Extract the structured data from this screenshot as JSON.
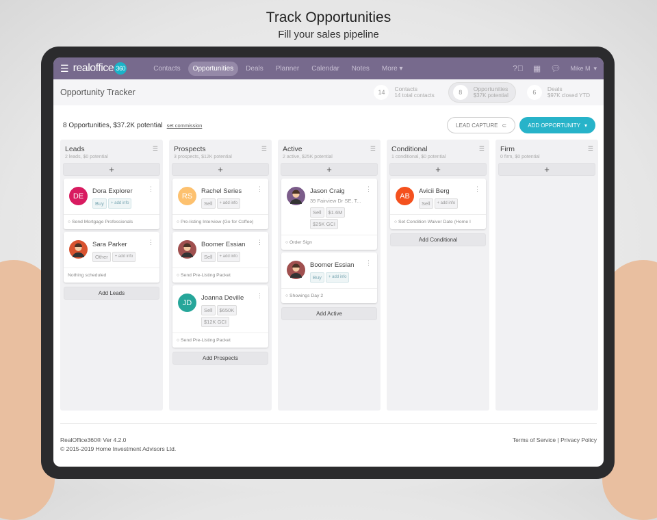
{
  "hero": {
    "title": "Track Opportunities",
    "subtitle": "Fill your sales pipeline"
  },
  "nav": {
    "logo": "realoffice",
    "logo_badge": "360",
    "items": [
      "Contacts",
      "Opportunities",
      "Deals",
      "Planner",
      "Calendar",
      "Notes",
      "More ▾"
    ],
    "active": "Opportunities",
    "user": "Mike M"
  },
  "header": {
    "title": "Opportunity Tracker",
    "stats": [
      {
        "n": "14",
        "label": "Contacts",
        "sub": "14 total contacts"
      },
      {
        "n": "8",
        "label": "Opportunities",
        "sub": "$37K potential",
        "active": true
      },
      {
        "n": "6",
        "label": "Deals",
        "sub": "$97K closed YTD"
      }
    ]
  },
  "toolbar": {
    "summary": "8 Opportunities, $37.2K potential",
    "set_commission": "set commission",
    "lead_capture": "LEAD CAPTURE",
    "add_opportunity": "ADD OPPORTUNITY"
  },
  "colors": {
    "nav": "#776a8d",
    "accent": "#27b3c9"
  },
  "columns": [
    {
      "title": "Leads",
      "summary": "2 leads, $0 potential",
      "add": "Add Leads",
      "cards": [
        {
          "name": "Dora Explorer",
          "initials": "DE",
          "color": "#d81b60",
          "tags": [
            "Buy",
            "+ add info"
          ],
          "task": "Send Mortgage Professionals"
        },
        {
          "name": "Sara Parker",
          "avatar": "#d9532f",
          "tags": [
            "Other",
            "+ add info"
          ],
          "task": "Nothing scheduled",
          "no_dot": true
        }
      ]
    },
    {
      "title": "Prospects",
      "summary": "3 prospects, $12K potential",
      "add": "Add Prospects",
      "cards": [
        {
          "name": "Rachel Series",
          "initials": "RS",
          "color": "#fdc16f",
          "tags": [
            "Sell",
            "+ add info"
          ],
          "task": "Pre-listing Interview (Go for Coffee)"
        },
        {
          "name": "Boomer Essian",
          "avatar": "#a0504f",
          "tags": [
            "Sell",
            "+ add info"
          ],
          "task": "Send Pre-Listing Packet"
        },
        {
          "name": "Joanna Deville",
          "initials": "JD",
          "color": "#26a69a",
          "tags": [
            "Sell",
            "$650K",
            "$12K GCI"
          ],
          "task": "Send Pre-Listing Packet"
        }
      ]
    },
    {
      "title": "Active",
      "summary": "2 active, $25K potential",
      "add": "Add Active",
      "cards": [
        {
          "name": "Jason Craig",
          "address": "39 Fairview Dr SE, T...",
          "avatar": "#7b5c8a",
          "tags": [
            "Sell",
            "$1.6M",
            "$25K GCI"
          ],
          "task": "Order Sign"
        },
        {
          "name": "Boomer Essian",
          "avatar": "#a0504f",
          "tags": [
            "Buy",
            "+ add info"
          ],
          "task": "Showings Day 2"
        }
      ]
    },
    {
      "title": "Conditional",
      "summary": "1 conditional, $0 potential",
      "add": "Add Conditional",
      "cards": [
        {
          "name": "Avicii Berg",
          "initials": "AB",
          "color": "#f4511e",
          "tags": [
            "Sell",
            "+ add info"
          ],
          "task": "Set Condition Waiver Date (Home I"
        }
      ]
    },
    {
      "title": "Firm",
      "summary": "0 firm, $0 potential",
      "cards": []
    }
  ],
  "footer": {
    "version": "RealOffice360® Ver 4.2.0",
    "copyright": "© 2015-2019 Home Investment Advisors Ltd.",
    "terms": "Terms of Service",
    "privacy": "Privacy Policy",
    "sep": "|"
  }
}
